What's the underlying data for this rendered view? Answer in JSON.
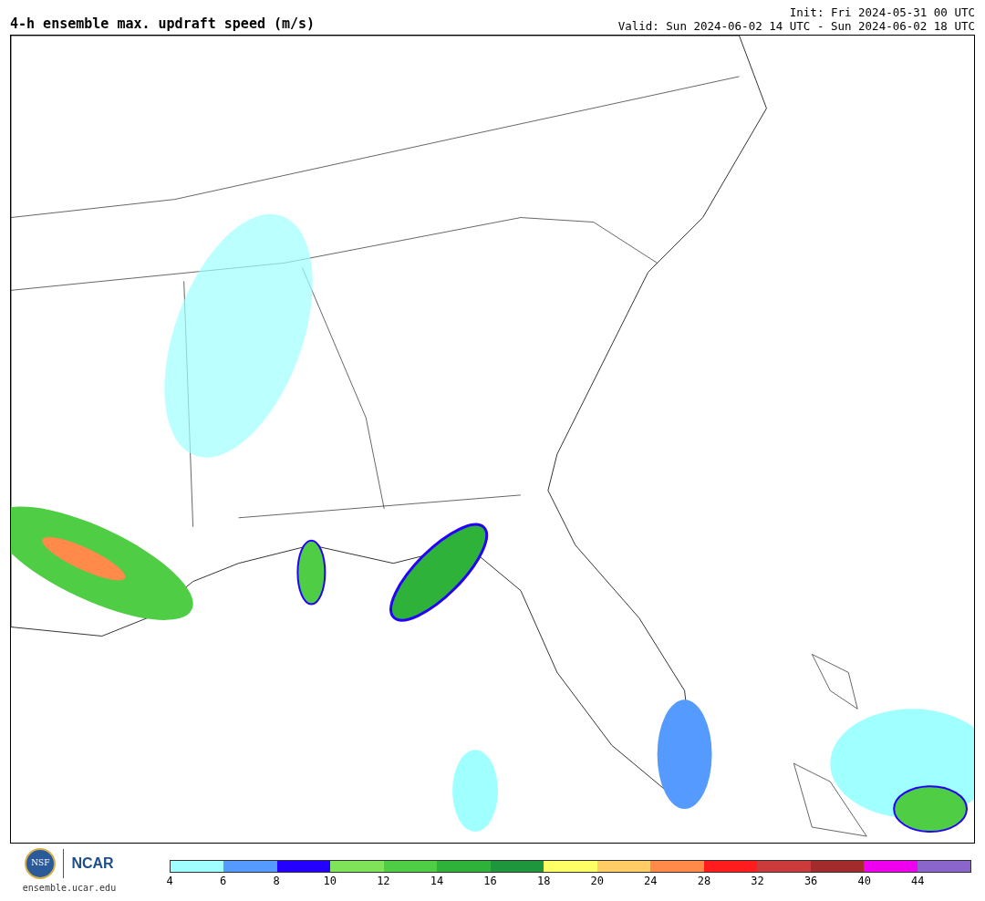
{
  "title": "4-h ensemble max. updraft speed (m/s)",
  "init": "Init: Fri 2024-05-31 00 UTC",
  "valid": "Valid: Sun 2024-06-02 14 UTC - Sun 2024-06-02 18 UTC",
  "logos": {
    "nsf": "NSF",
    "ncar": "NCAR",
    "url": "ensemble.ucar.edu"
  },
  "colorbar": [
    {
      "label": "4",
      "color": "#a0ffff"
    },
    {
      "label": "6",
      "color": "#559bff"
    },
    {
      "label": "8",
      "color": "#2400ff"
    },
    {
      "label": "10",
      "color": "#80e45a"
    },
    {
      "label": "12",
      "color": "#4fcd44"
    },
    {
      "label": "14",
      "color": "#2fb23a"
    },
    {
      "label": "16",
      "color": "#1e963c"
    },
    {
      "label": "18",
      "color": "#ffff66"
    },
    {
      "label": "20",
      "color": "#ffcc66"
    },
    {
      "label": "24",
      "color": "#ff8a4a"
    },
    {
      "label": "28",
      "color": "#ff1c1c"
    },
    {
      "label": "32",
      "color": "#cc3b3b"
    },
    {
      "label": "36",
      "color": "#a22c2c"
    },
    {
      "label": "40",
      "color": "#ef00ef"
    },
    {
      "label": "44",
      "color": "#8a66cc"
    }
  ]
}
